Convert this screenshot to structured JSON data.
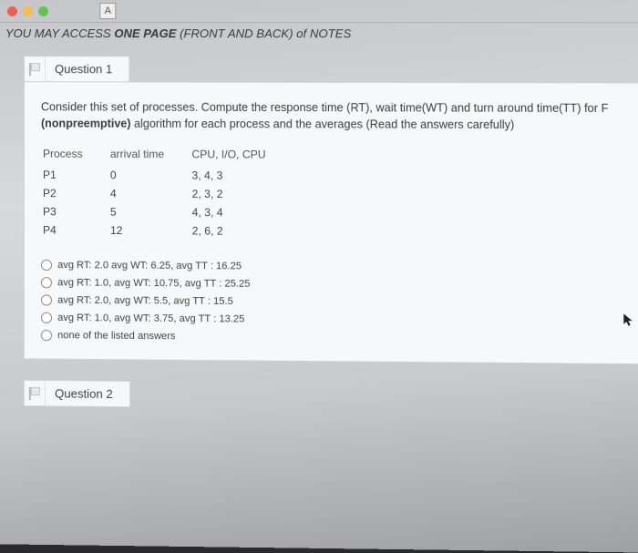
{
  "tab_letter": "A",
  "instruction_pre": "YOU MAY ACCESS ",
  "instruction_bold": "ONE PAGE",
  "instruction_mid": " (FRONT AND BACK) of NOTES",
  "question1": {
    "title": "Question 1",
    "prompt_pre": "Consider this set of processes. Compute the  response time (RT), wait time(WT) and turn around time(TT) for F",
    "prompt_bold": "(nonpreemptive)",
    "prompt_post": " algorithm for each process and the averages (Read the answers carefully)",
    "headers": {
      "c1": "Process",
      "c2": "arrival time",
      "c3": "CPU, I/O, CPU"
    },
    "rows": [
      {
        "p": "P1",
        "a": "0",
        "b": "3,  4,  3"
      },
      {
        "p": "P2",
        "a": "4",
        "b": "2,  3,  2"
      },
      {
        "p": "P3",
        "a": "5",
        "b": "4,  3,  4"
      },
      {
        "p": "P4",
        "a": "12",
        "b": "2,  6,  2"
      }
    ],
    "options": [
      "avg RT: 2.0 avg WT: 6.25, avg TT : 16.25",
      "avg RT: 1.0, avg WT: 10.75, avg TT : 25.25",
      "avg RT: 2.0, avg WT: 5.5, avg TT : 15.5",
      "avg RT: 1.0, avg WT: 3.75, avg TT : 13.25",
      "none of the listed answers"
    ]
  },
  "question2": {
    "title": "Question 2"
  }
}
